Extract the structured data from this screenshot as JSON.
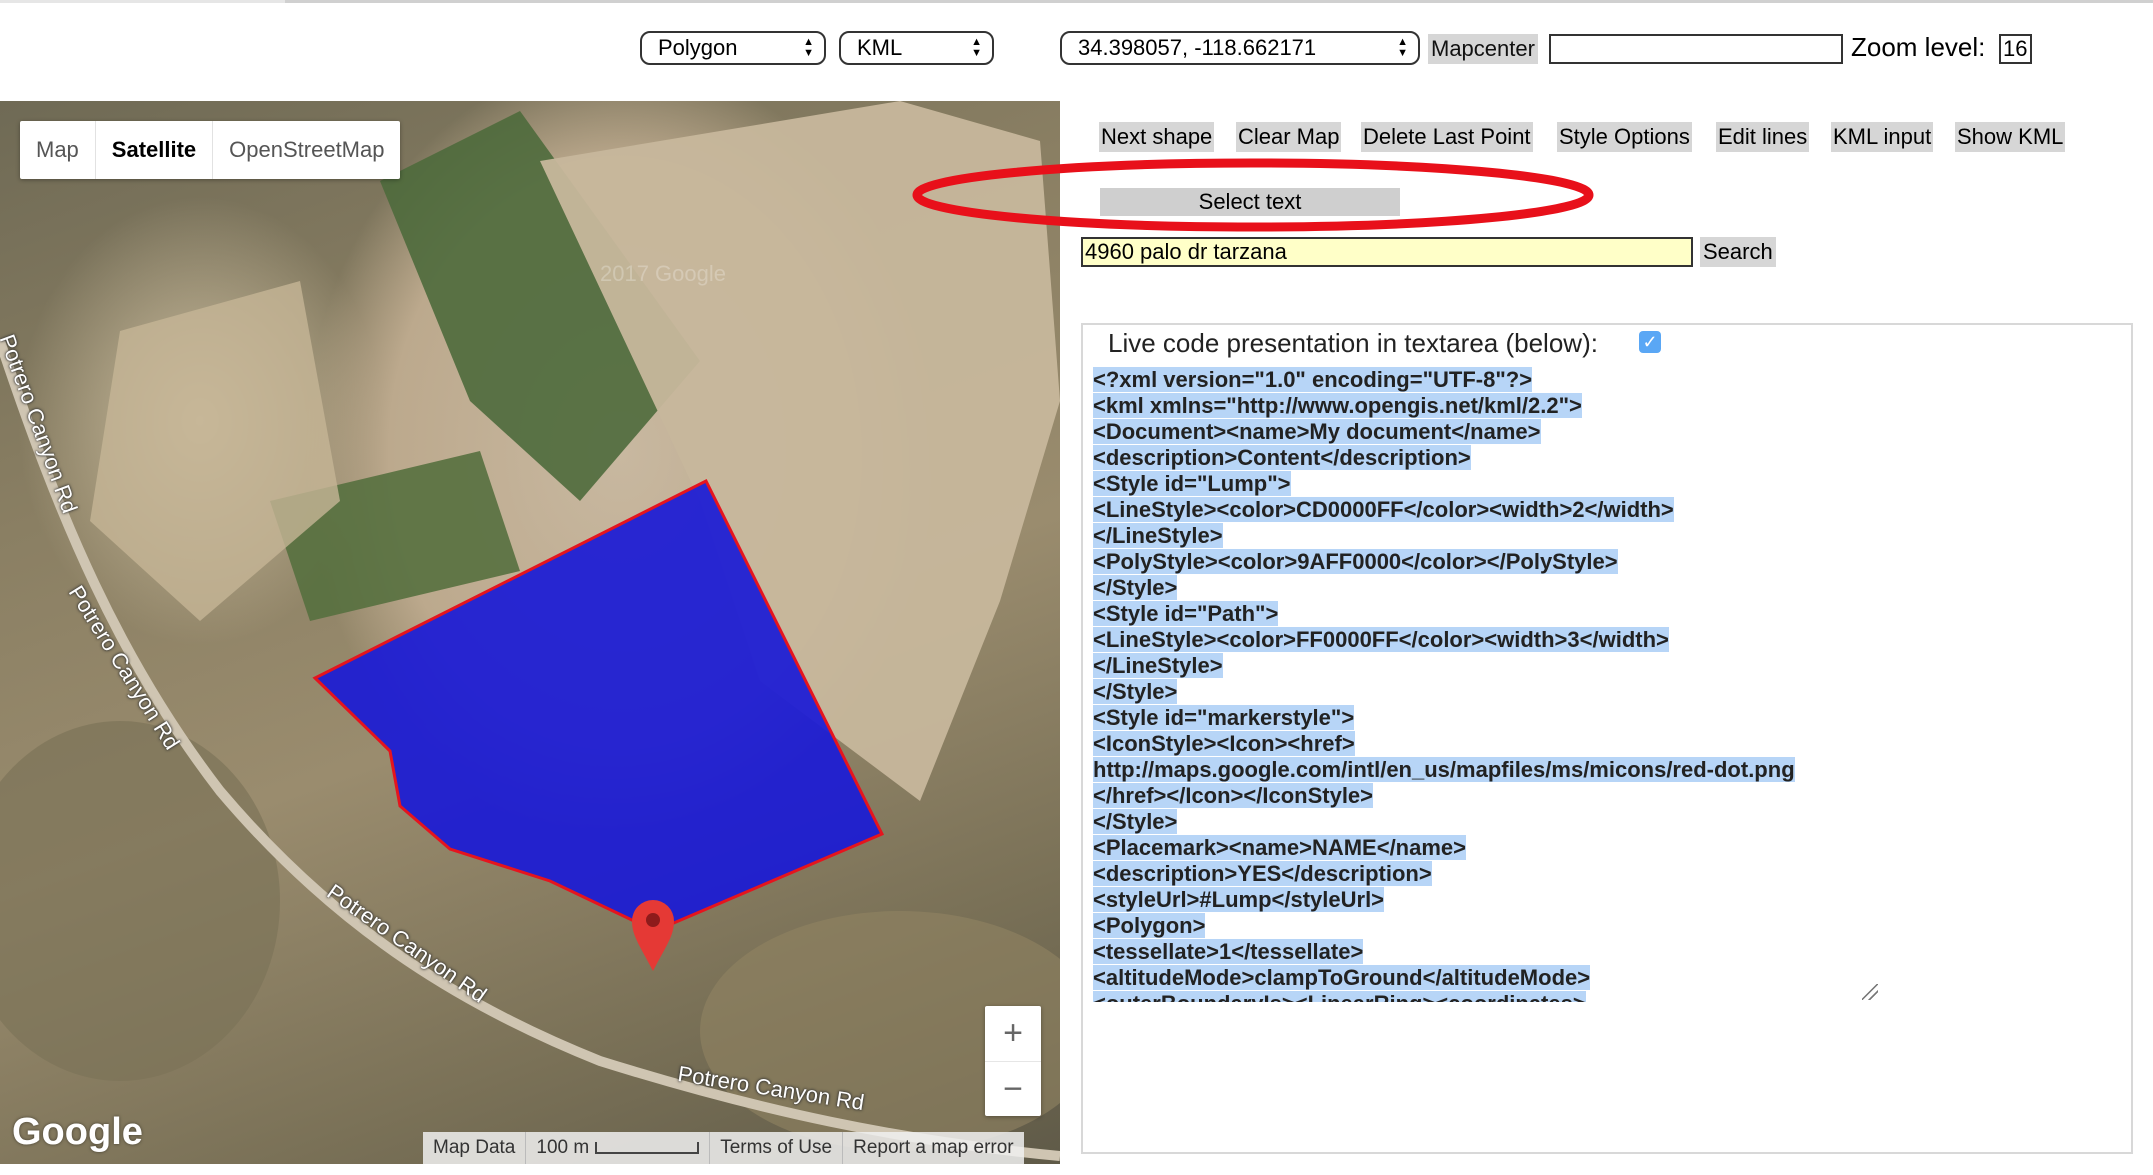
{
  "top_controls": {
    "shape_select": "Polygon",
    "format_select": "KML",
    "coords_select": "34.398057, -118.662171",
    "mapcenter_label": "Mapcenter",
    "mapcenter_input": "",
    "zoom_label": "Zoom level:",
    "zoom_value": "16"
  },
  "map": {
    "mode_tabs": [
      {
        "label": "Map",
        "active": false
      },
      {
        "label": "Satellite",
        "active": true
      },
      {
        "label": "OpenStreetMap",
        "active": false
      }
    ],
    "watermark": "2017 Google",
    "road_label": "Potrero Canyon Rd",
    "zoom_in": "+",
    "zoom_out": "−",
    "logo": "Google",
    "footer": {
      "map_data": "Map Data",
      "scale": "100 m",
      "terms": "Terms of Use",
      "report": "Report a map error"
    },
    "polygon_fill_color": "#1a1ad6",
    "polygon_stroke_color": "#e5141e",
    "marker_color": "#e53935"
  },
  "toolbar": {
    "buttons": [
      "Next shape",
      "Clear Map",
      "Delete Last Point",
      "Style Options",
      "Edit lines",
      "KML input",
      "Show KML"
    ],
    "select_text": "Select text"
  },
  "search": {
    "value": "4960 palo dr tarzana",
    "button": "Search"
  },
  "code_panel": {
    "label": "Live code presentation in textarea (below):",
    "checked": true,
    "lines": [
      "<?xml version=\"1.0\" encoding=\"UTF-8\"?>",
      "<kml xmlns=\"http://www.opengis.net/kml/2.2\">",
      "<Document><name>My document</name>",
      "<description>Content</description>",
      "<Style id=\"Lump\">",
      "<LineStyle><color>CD0000FF</color><width>2</width>",
      "</LineStyle>",
      "<PolyStyle><color>9AFF0000</color></PolyStyle>",
      "</Style>",
      "<Style id=\"Path\">",
      "<LineStyle><color>FF0000FF</color><width>3</width>",
      "</LineStyle>",
      "</Style>",
      "<Style id=\"markerstyle\">",
      "<IconStyle><Icon><href>",
      "http://maps.google.com/intl/en_us/mapfiles/ms/micons/red-dot.png",
      "</href></Icon></IconStyle>",
      "</Style>",
      "<Placemark><name>NAME</name>",
      "<description>YES</description>",
      "<styleUrl>#Lump</styleUrl>",
      "<Polygon>",
      "<tessellate>1</tessellate>",
      "<altitudeMode>clampToGround</altitudeMode>",
      "<outerBoundaryIs><LinearRing><coordinates>"
    ]
  },
  "annotation_color": "#e8101a"
}
